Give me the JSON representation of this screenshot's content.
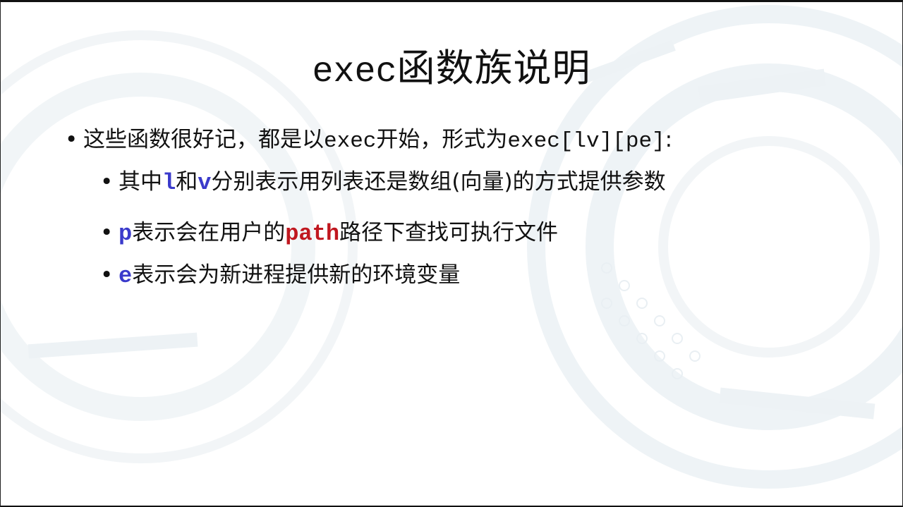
{
  "slide": {
    "title_code": "exec",
    "title_text": "函数族说明",
    "bullet1": {
      "text_a": "这些函数很好记，都是以",
      "code_a": "exec",
      "text_b": "开始，形式为",
      "code_b": "exec[lv][pe]",
      "text_c": ":"
    },
    "bullet2": {
      "text_a": "其中",
      "kw_l": "l",
      "text_b": "和",
      "kw_v": "v",
      "text_c": "分别表示用列表还是数组(向量)的方式提供参数"
    },
    "bullet3": {
      "kw_p": "p",
      "text_a": "表示会在用户的",
      "kw_path": "path",
      "text_b": "路径下查找可执行文件"
    },
    "bullet4": {
      "kw_e": "e",
      "text_a": "表示会为新进程提供新的环境变量"
    },
    "bullet_symbol": "•"
  },
  "colors": {
    "keyword_blue": "#3a3acb",
    "keyword_red": "#c0171f",
    "text": "#111111",
    "background": "#ffffff",
    "decor": "#eef3f6"
  }
}
